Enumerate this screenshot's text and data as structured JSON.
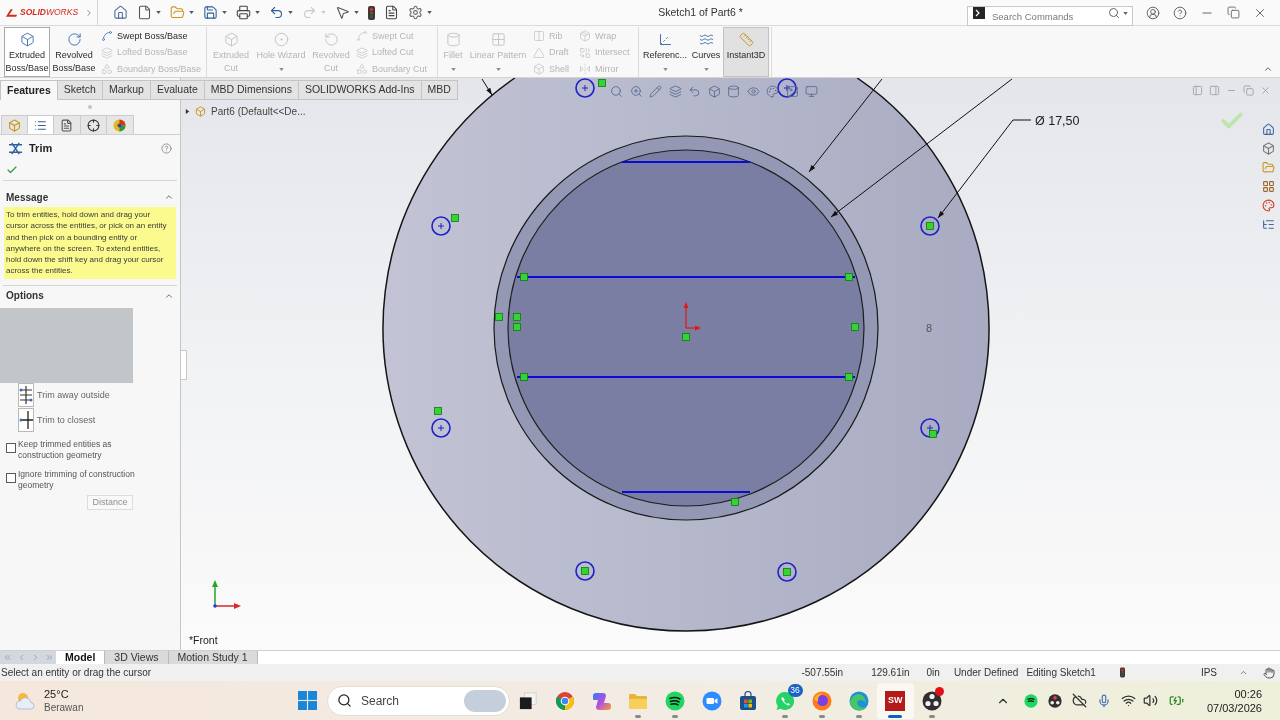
{
  "title_bar": {
    "logo": "**SOLID**WORKS",
    "quick_access": [
      {
        "disabled": false
      },
      {
        "disabled": false
      },
      {
        "disabled": false
      },
      {
        "disabled": false
      },
      {
        "disabled": false
      },
      {
        "disabled": false
      },
      {
        "disabled": true
      },
      {
        "disabled": false
      },
      {
        "disabled": false
      },
      {
        "disabled": false
      },
      {
        "disabled": false
      }
    ],
    "document_title": "Sketch1 of Part6 *",
    "search": {
      "placeholder": "Search Commands"
    }
  },
  "command_manager": {
    "groups": [
      {
        "items": [
          {
            "kind": "large",
            "label": "Extruded Boss/Base",
            "disabled": false,
            "hovered": true,
            "pressed": false,
            "dropdown": false
          },
          {
            "kind": "large",
            "label": "Revolved Boss/Base",
            "disabled": false,
            "hovered": false,
            "pressed": false,
            "dropdown": false
          },
          {
            "kind": "stack",
            "items": [
              {
                "label": "Swept Boss/Base",
                "disabled": false
              },
              {
                "label": "Lofted Boss/Base",
                "disabled": true
              },
              {
                "label": "Boundary Boss/Base",
                "disabled": true
              }
            ]
          }
        ]
      },
      {
        "items": [
          {
            "kind": "large",
            "label": "Extruded Cut",
            "disabled": true,
            "hovered": false,
            "pressed": false,
            "dropdown": false
          },
          {
            "kind": "large",
            "label": "Hole Wizard",
            "disabled": true,
            "hovered": false,
            "pressed": false,
            "dropdown": true
          },
          {
            "kind": "large",
            "label": "Revolved Cut",
            "disabled": true,
            "hovered": false,
            "pressed": false,
            "dropdown": false
          },
          {
            "kind": "stack",
            "items": [
              {
                "label": "Swept Cut",
                "disabled": true
              },
              {
                "label": "Lofted Cut",
                "disabled": true
              },
              {
                "label": "Boundary Cut",
                "disabled": true
              }
            ]
          }
        ]
      },
      {
        "items": [
          {
            "kind": "large",
            "label": "Fillet",
            "disabled": true,
            "hovered": false,
            "pressed": false,
            "dropdown": true
          },
          {
            "kind": "large",
            "label": "Linear Pattern",
            "disabled": true,
            "hovered": false,
            "pressed": false,
            "dropdown": true
          },
          {
            "kind": "stack",
            "items": [
              {
                "label": "Rib",
                "disabled": true
              },
              {
                "label": "Draft",
                "disabled": true
              },
              {
                "label": "Shell",
                "disabled": true
              }
            ]
          },
          {
            "kind": "stack",
            "items": [
              {
                "label": "Wrap",
                "disabled": true
              },
              {
                "label": "Intersect",
                "disabled": true
              },
              {
                "label": "Mirror",
                "disabled": true
              }
            ]
          }
        ]
      },
      {
        "items": [
          {
            "kind": "large",
            "label": "Referenc...",
            "disabled": false,
            "hovered": false,
            "pressed": false,
            "dropdown": true
          },
          {
            "kind": "large",
            "label": "Curves",
            "disabled": false,
            "hovered": false,
            "pressed": false,
            "dropdown": true
          },
          {
            "kind": "large",
            "label": "Instant3D",
            "disabled": false,
            "hovered": false,
            "pressed": true,
            "dropdown": false
          }
        ]
      }
    ]
  },
  "tabs": [
    {
      "label": "Features",
      "selected": true
    },
    {
      "label": "Sketch",
      "selected": false
    },
    {
      "label": "Markup",
      "selected": false
    },
    {
      "label": "Evaluate",
      "selected": false
    },
    {
      "label": "MBD Dimensions",
      "selected": false
    },
    {
      "label": "SOLIDWORKS Add-Ins",
      "selected": false
    },
    {
      "label": "MBD",
      "selected": false
    }
  ],
  "property_manager": {
    "tabs": [
      {
        "selected": false
      },
      {
        "selected": true
      },
      {
        "selected": false
      },
      {
        "selected": false
      },
      {
        "selected": false
      }
    ],
    "title": "Trim",
    "message": {
      "title": "Message",
      "expanded": true,
      "text": "To trim entities, hold down and drag your cursor across the entities, or pick on an entity and then pick on a bounding entity or anywhere on the screen. To extend entities, hold down the shift key and drag your cursor across the entities."
    },
    "options": {
      "title": "Options",
      "expanded": true,
      "trim_modes": [
        {
          "label": "Trim away outside",
          "selected": false
        },
        {
          "label": "Trim to closest",
          "selected": false
        }
      ],
      "checkboxes": [
        {
          "label": "Keep trimmed entities as construction geometry",
          "checked": false
        },
        {
          "label": "Ignore trimming of construction geometry",
          "checked": false
        }
      ],
      "distance": {
        "label": "Distance",
        "disabled": true
      }
    }
  },
  "graphics": {
    "tree": {
      "label": "Part6 (Default<<De...",
      "expanded": false
    },
    "dimension": "Ø 17,50",
    "note": "8",
    "view_label": "*Front"
  },
  "bottom_tabs": [
    {
      "label": "Model",
      "selected": true
    },
    {
      "label": "3D Views",
      "selected": false
    },
    {
      "label": "Motion Study 1",
      "selected": false
    }
  ],
  "status_bar": {
    "message": "Select an entity or drag the cursor",
    "x": "-507.55in",
    "y": "129.61in",
    "z": "0in",
    "sketch_state": "Under Defined",
    "editing": "Editing Sketch1",
    "units": "IPS"
  },
  "taskbar": {
    "weather": {
      "temperature": "25°C",
      "condition": "Berawan"
    },
    "search": {
      "placeholder": "Search"
    },
    "apps": [
      {
        "kind": "taskview",
        "running": false,
        "active": false,
        "notification": false
      },
      {
        "kind": "globe",
        "running": false,
        "active": false,
        "notification": false
      },
      {
        "kind": "sparkle",
        "running": false,
        "active": false,
        "notification": false
      },
      {
        "kind": "folder",
        "running": true,
        "active": false,
        "notification": false
      },
      {
        "kind": "music",
        "running": true,
        "active": false,
        "notification": false
      },
      {
        "kind": "meeting",
        "running": false,
        "active": false,
        "notification": false
      },
      {
        "kind": "store",
        "running": false,
        "active": false,
        "notification": false
      },
      {
        "kind": "chat",
        "running": true,
        "active": false,
        "notification": false,
        "badge": "36"
      },
      {
        "kind": "fox",
        "running": true,
        "active": false,
        "notification": false
      },
      {
        "kind": "wave",
        "running": true,
        "active": false,
        "notification": false
      },
      {
        "kind": "cad",
        "running": true,
        "active": true,
        "notification": false,
        "label": "SW"
      },
      {
        "kind": "recorder",
        "running": true,
        "active": false,
        "notification": true
      }
    ],
    "clock": {
      "time": "00:26",
      "date": "07/03/2026"
    }
  }
}
